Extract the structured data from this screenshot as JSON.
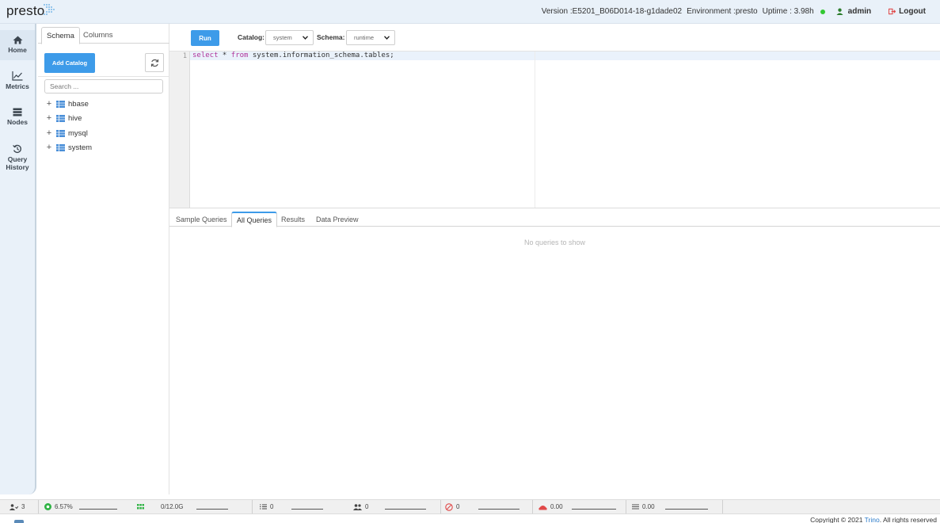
{
  "header": {
    "logo_text": "presto",
    "version_text": "Version :E5201_B06D014-18-g1dade02",
    "environment_text": "Environment :presto",
    "uptime_text": "Uptime : 3.98h",
    "status_color": "#32c832",
    "user_label": "admin",
    "logout_label": "Logout"
  },
  "nav": {
    "items": [
      {
        "label": "Home",
        "icon": "home-icon"
      },
      {
        "label": "Metrics",
        "icon": "chart-icon"
      },
      {
        "label": "Nodes",
        "icon": "server-icon"
      },
      {
        "label": "Query",
        "label2": "History",
        "icon": "history-icon"
      }
    ]
  },
  "schema_panel": {
    "tabs": [
      "Schema",
      "Columns"
    ],
    "add_catalog_label": "Add Catalog",
    "search_placeholder": "Search ...",
    "catalogs": [
      "hbase",
      "hive",
      "mysql",
      "system"
    ]
  },
  "toolbar": {
    "run_label": "Run",
    "catalog_label": "Catalog:",
    "catalog_value": "system",
    "schema_label": "Schema:",
    "schema_value": "runtime"
  },
  "editor": {
    "line_number": "1",
    "kw_select": "select",
    "star": " * ",
    "kw_from": "from",
    "rest": " system.information_schema.tables;"
  },
  "results": {
    "tabs": [
      "Sample Queries",
      "All Queries",
      "Results",
      "Data Preview"
    ],
    "active_tab": "All Queries",
    "empty_text": "No queries to show"
  },
  "status_bar": {
    "users": "3",
    "cpu": "6.57%",
    "memory": "0/12.0G",
    "queued": "0",
    "running": "0",
    "failed": "0",
    "rate1": "0.00",
    "rate2": "0.00"
  },
  "footer": {
    "copyright_prefix": "Copyright © 2021 ",
    "brand": "Trino",
    "copyright_suffix": ". All rights reserved"
  },
  "colors": {
    "accent": "#3d9be9",
    "header_bg": "#e9f1f9",
    "keyword": "#b0349a",
    "cpu_green": "#2fb344",
    "failed_red": "#e04848"
  }
}
